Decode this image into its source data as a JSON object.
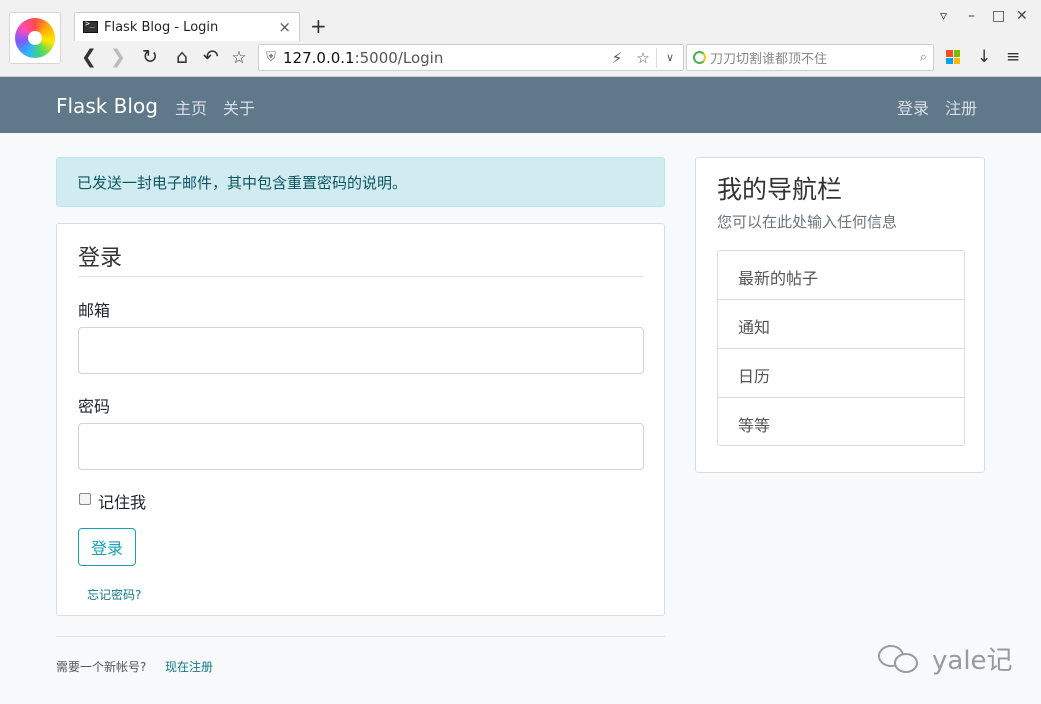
{
  "browser": {
    "tab_title": "Flask Blog - Login",
    "tab_close": "×",
    "new_tab": "+",
    "url_host": "127.0.0.1",
    "url_path": ":5000/Login",
    "search_placeholder": "刀刀切割谁都顶不住",
    "icons": {
      "back": "back-arrow-icon",
      "forward": "forward-arrow-icon",
      "reload": "reload-icon",
      "home": "home-icon",
      "undo": "undo-icon",
      "bookmark": "star-icon",
      "download": "download-icon",
      "menu": "hamburger-menu-icon"
    }
  },
  "navbar": {
    "brand": "Flask Blog",
    "links": [
      "主页",
      "关于"
    ],
    "right_links": [
      "登录",
      "注册"
    ],
    "bg_color": "#5f788a"
  },
  "alert": {
    "message": "已发送一封电子邮件，其中包含重置密码的说明。"
  },
  "login": {
    "legend": "登录",
    "email_label": "邮箱",
    "email_value": "",
    "password_label": "密码",
    "password_value": "",
    "remember_label": "记住我",
    "remember_checked": false,
    "submit_label": "登录",
    "forgot_label": "忘记密码?"
  },
  "footer": {
    "register_text": "需要一个新帐号?",
    "register_link": "现在注册"
  },
  "sidebar": {
    "title": "我的导航栏",
    "subtitle": "您可以在此处输入任何信息",
    "items": [
      "最新的帖子",
      "通知",
      "日历",
      "等等"
    ]
  },
  "watermark": {
    "text": "yale记"
  },
  "colors": {
    "accent": "#17a2b8",
    "alert_bg": "#d1ecf1",
    "alert_text": "#0c5460"
  }
}
